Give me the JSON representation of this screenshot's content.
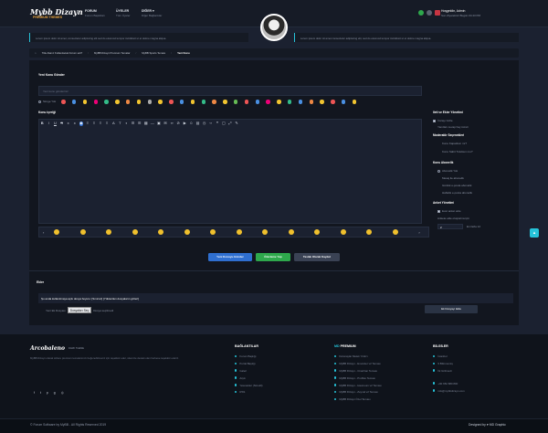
{
  "header": {
    "logo": "Mybb Dizayn",
    "logo_sub": "PREMIUM THEMES",
    "nav": [
      {
        "label": "FORUM",
        "sub": "Forum Başlıkları"
      },
      {
        "label": "ÜYELER",
        "sub": "Tüm Üyeler"
      },
      {
        "label": "DİĞER ▾",
        "sub": "Diğer Bağlantılar"
      }
    ],
    "user_greeting": "Hoşgeldin, Admin",
    "user_sub": "Son Ziyaretiniz Bugün 04:43 PM"
  },
  "notices": [
    "Lorem ipsum dolor sit amet, consectetur adipiscing elit sed do eiusmod tempor incididunt ut et dolore magna aliqua.",
    "Lorem ipsum dolor sit amet consectetur adipiscing elit, sed do eiusmod tempor incididunt ut et dolore magna aliqua."
  ],
  "breadcrumb": [
    "Title Alanız Kullanılacak Forum adı?",
    "MyBB Dizayn Premium Temalar",
    "MyBB Sports Teması",
    "Yeni Konu"
  ],
  "form": {
    "section_title": "Yeni Konu Gönder",
    "subject_placeholder": "Yeni konu gönderiniz",
    "icon_label": "Simge Yok",
    "body_label": "Konu içeriği"
  },
  "sidebar": {
    "options_title": "Ileti ve Ekler Yönetimi",
    "options": [
      "İmzayı Gizle",
      "Yanıtları cevap hay ücreti"
    ],
    "moderation_title": "Moderatör Seçenekleri",
    "moderation": [
      "Konu Kapatılsın mı?",
      "Konu Sabit Tutulsun mu?"
    ],
    "rating_title": "Konu Abonelik",
    "rating": [
      "Abonelik Yok",
      "Mesaj ile abonelik",
      "Günlük e-posta abonelik",
      "Haftalık e-posta abonelik",
      "Anlık e-posta abonelik"
    ],
    "poll_title": "Anket Yönetimi",
    "poll_check": "Evet anket ekle",
    "poll_note": "Ankete ekle oluşturma için",
    "poll_option_count": "2",
    "poll_option_label": "En fazla 12"
  },
  "buttons": {
    "submit": "Yeni Konuyu Gönder",
    "preview": "Önizleme Yap",
    "draft": "Taslak Olarak Kaydet"
  },
  "attachments": {
    "title": "Ekler",
    "note": "Şu anda kullanılmaya açık dosya boyutu: [Sınırsız] [Yüklenilen dosyaların gizleri]",
    "file_label": "Yeni Ek Dosyası",
    "file_button": "Dosyaları Seç",
    "file_status": "Dosya seçilmedi",
    "upload_button": "Ek Dosyayı Ekle"
  },
  "footer": {
    "brand": "Arcobaleno",
    "brand_sub": "DARK THEME",
    "about": "MyBB Dizayn olarak sizlere premium temalarımızı beğenebilmeniz için teşekkür eder, sitemize destek olan herkese teşekkür ederiz.",
    "col1_title": "BAĞLANTILAR",
    "col1": [
      "Forum Başlığı",
      "Portal Başlığı",
      "Galeri",
      "Arşiv",
      "Yetenekler (Sürekli)",
      "RSS"
    ],
    "col2_title": "PREMIUM",
    "col2": [
      "Dolunaylar Melek Yıldızı",
      "MyBB Dizayn - Envanter v2 Teması",
      "MyBB Dizayn - Cinarhan Teması",
      "MyBB Dizayn - Profilav Teması",
      "MyBB Dizayn - Haunoum v2 Teması",
      "MyBB Dizayn - Zeynal v2 Teması",
      "MyBB Dizayn Özel Teması"
    ],
    "col3_title": "BİLGİLER",
    "col3": [
      "İstanbul",
      "9 Bilinmemiş",
      "İlk Girilmedi",
      "+90 652 880 800",
      "info@mybbdizayn.com"
    ],
    "copyright": "© Forum Software by MyBB - All Rights Reserved 2019",
    "designed": "Designed by ♥ MD Graphic"
  },
  "colors": {
    "accent": "#26c3d9",
    "submit": "#2f6fd0",
    "preview": "#2ea84c",
    "draft": "#3a4254"
  }
}
